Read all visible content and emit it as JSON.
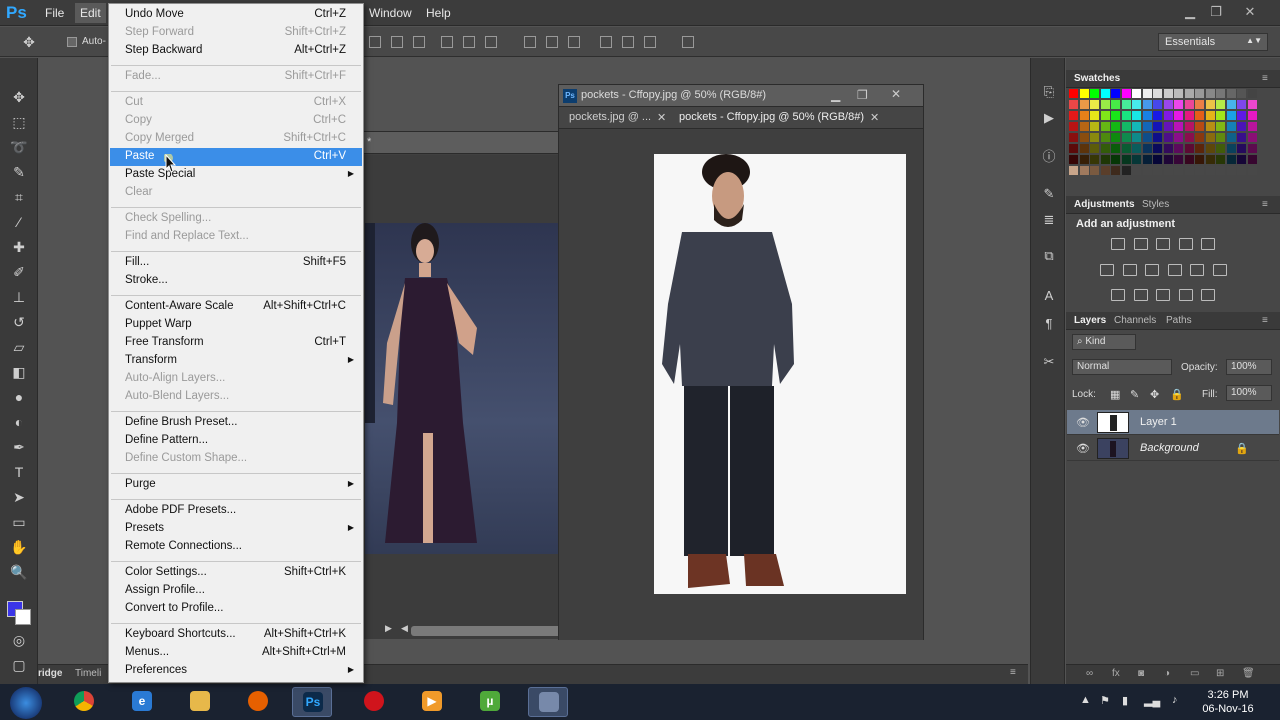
{
  "app": {
    "logo": "Ps",
    "menus": [
      "File",
      "Edit",
      "Window",
      "Help"
    ]
  },
  "options_bar": {
    "auto_select": "Auto-",
    "workspace": "Essentials"
  },
  "edit_menu": {
    "items": [
      {
        "label": "Undo Move",
        "shortcut": "Ctrl+Z",
        "disabled": false
      },
      {
        "label": "Step Forward",
        "shortcut": "Shift+Ctrl+Z",
        "disabled": true
      },
      {
        "label": "Step Backward",
        "shortcut": "Alt+Ctrl+Z",
        "disabled": false
      },
      {
        "label": "Fade...",
        "shortcut": "Shift+Ctrl+F",
        "disabled": true
      },
      {
        "label": "Cut",
        "shortcut": "Ctrl+X",
        "disabled": true
      },
      {
        "label": "Copy",
        "shortcut": "Ctrl+C",
        "disabled": true
      },
      {
        "label": "Copy Merged",
        "shortcut": "Shift+Ctrl+C",
        "disabled": true
      },
      {
        "label": "Paste",
        "shortcut": "Ctrl+V",
        "disabled": false,
        "highlighted": true
      },
      {
        "label": "Paste Special",
        "shortcut": "",
        "disabled": false,
        "submenu": true
      },
      {
        "label": "Clear",
        "shortcut": "",
        "disabled": true
      },
      {
        "label": "Check Spelling...",
        "shortcut": "",
        "disabled": true
      },
      {
        "label": "Find and Replace Text...",
        "shortcut": "",
        "disabled": true
      },
      {
        "label": "Fill...",
        "shortcut": "Shift+F5",
        "disabled": false
      },
      {
        "label": "Stroke...",
        "shortcut": "",
        "disabled": false
      },
      {
        "label": "Content-Aware Scale",
        "shortcut": "Alt+Shift+Ctrl+C",
        "disabled": false
      },
      {
        "label": "Puppet Warp",
        "shortcut": "",
        "disabled": false
      },
      {
        "label": "Free Transform",
        "shortcut": "Ctrl+T",
        "disabled": false
      },
      {
        "label": "Transform",
        "shortcut": "",
        "disabled": false,
        "submenu": true
      },
      {
        "label": "Auto-Align Layers...",
        "shortcut": "",
        "disabled": true
      },
      {
        "label": "Auto-Blend Layers...",
        "shortcut": "",
        "disabled": true
      },
      {
        "label": "Define Brush Preset...",
        "shortcut": "",
        "disabled": false
      },
      {
        "label": "Define Pattern...",
        "shortcut": "",
        "disabled": false
      },
      {
        "label": "Define Custom Shape...",
        "shortcut": "",
        "disabled": true
      },
      {
        "label": "Purge",
        "shortcut": "",
        "disabled": false,
        "submenu": true
      },
      {
        "label": "Adobe PDF Presets...",
        "shortcut": "",
        "disabled": false
      },
      {
        "label": "Presets",
        "shortcut": "",
        "disabled": false,
        "submenu": true
      },
      {
        "label": "Remote Connections...",
        "shortcut": "",
        "disabled": false
      },
      {
        "label": "Color Settings...",
        "shortcut": "Shift+Ctrl+K",
        "disabled": false
      },
      {
        "label": "Assign Profile...",
        "shortcut": "",
        "disabled": false
      },
      {
        "label": "Convert to Profile...",
        "shortcut": "",
        "disabled": false
      },
      {
        "label": "Keyboard Shortcuts...",
        "shortcut": "Alt+Shift+Ctrl+K",
        "disabled": false
      },
      {
        "label": "Menus...",
        "shortcut": "Alt+Shift+Ctrl+M",
        "disabled": false
      },
      {
        "label": "Preferences",
        "shortcut": "",
        "disabled": false,
        "submenu": true
      }
    ]
  },
  "documents": {
    "front_window_title": "pockets - Cffopy.jpg @ 50% (RGB/8#)",
    "tab_1": "pockets.jpg @ ...",
    "tab_2": "pockets - Cffopy.jpg @ 50% (RGB/8#)",
    "back_window_title": "*"
  },
  "bottom_tabs": {
    "bridge": "ridge",
    "timeline": "Timeli"
  },
  "panels": {
    "swatches_tab": "Swatches",
    "adjustments_tab": "Adjustments",
    "styles_tab": "Styles",
    "adjustments_hint": "Add an adjustment",
    "layers_tab": "Layers",
    "channels_tab": "Channels",
    "paths_tab": "Paths",
    "filter_kind": "Kind",
    "blend_mode": "Normal",
    "opacity_label": "Opacity:",
    "opacity_value": "100%",
    "lock_label": "Lock:",
    "fill_label": "Fill:",
    "fill_value": "100%",
    "layers": [
      {
        "name": "Layer 1",
        "selected": true
      },
      {
        "name": "Background",
        "selected": false,
        "locked": true
      }
    ]
  },
  "taskbar": {
    "time": "3:26 PM",
    "date": "06-Nov-16"
  },
  "colors": {
    "foreground": "#3b35e8",
    "background": "#ffffff",
    "menu_highlight": "#3b8ee8"
  }
}
